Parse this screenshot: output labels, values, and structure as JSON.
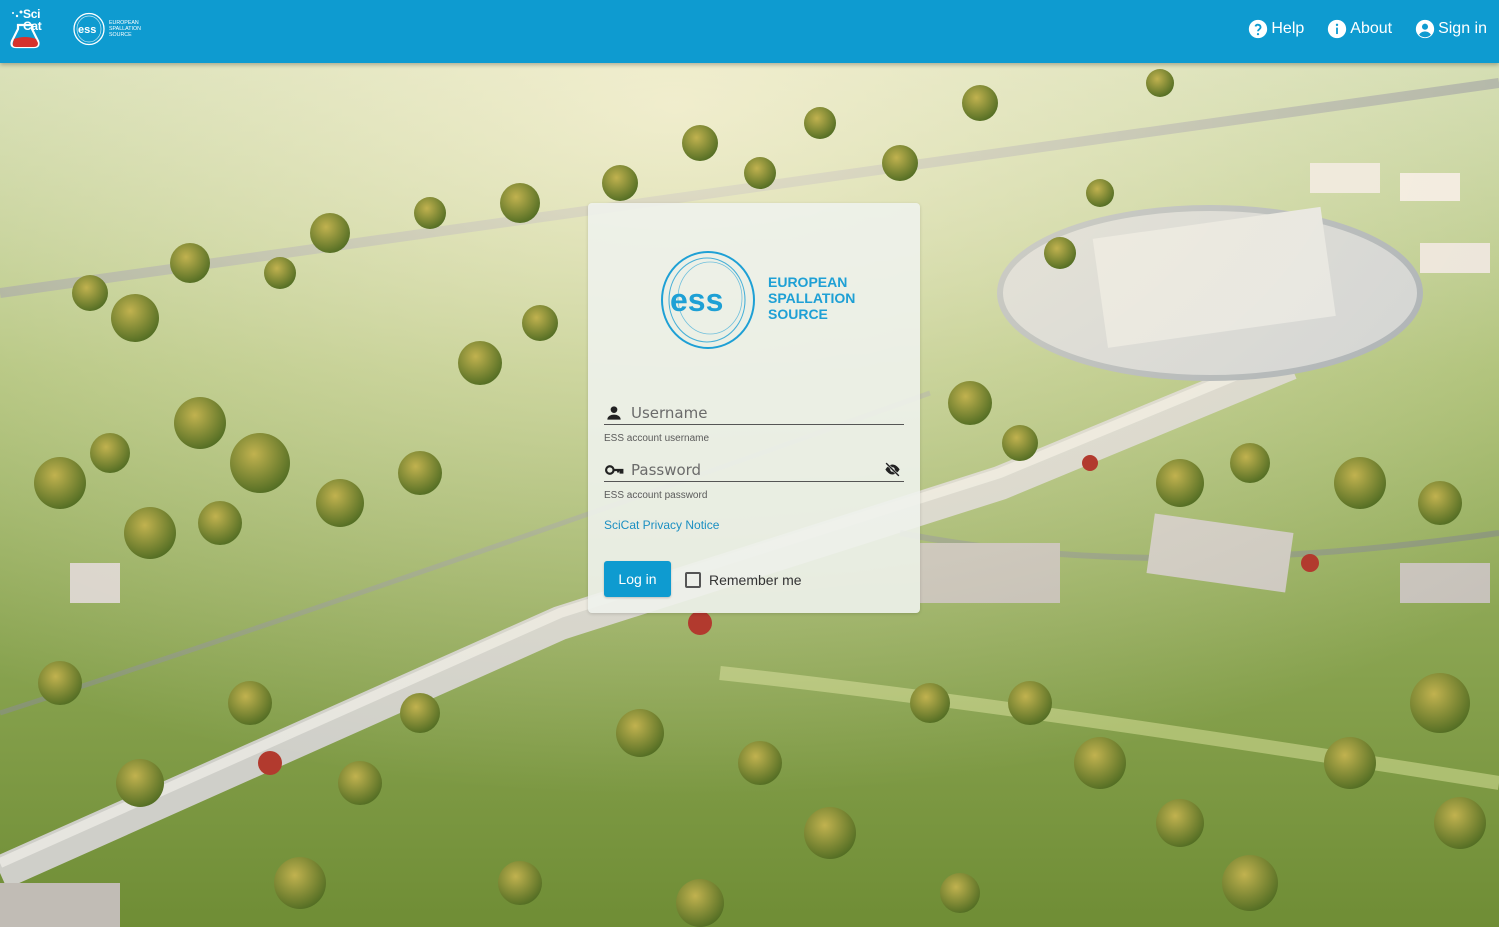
{
  "header": {
    "scicat_logo_text_line1": "SciCat",
    "nav": [
      {
        "label": "Help",
        "icon": "help-circle-icon"
      },
      {
        "label": "About",
        "icon": "info-icon"
      },
      {
        "label": "Sign in",
        "icon": "account-circle-icon"
      }
    ]
  },
  "logo": {
    "abbr": "ess",
    "line1": "EUROPEAN",
    "line2": "SPALLATION",
    "line3": "SOURCE"
  },
  "login": {
    "username_placeholder": "Username",
    "username_hint": "ESS account username",
    "password_placeholder": "Password",
    "password_hint": "ESS account password",
    "privacy_link": "SciCat Privacy Notice",
    "login_button": "Log in",
    "remember_label": "Remember me"
  },
  "colors": {
    "brand": "#0e9bd0",
    "link": "#1b8fc2"
  }
}
